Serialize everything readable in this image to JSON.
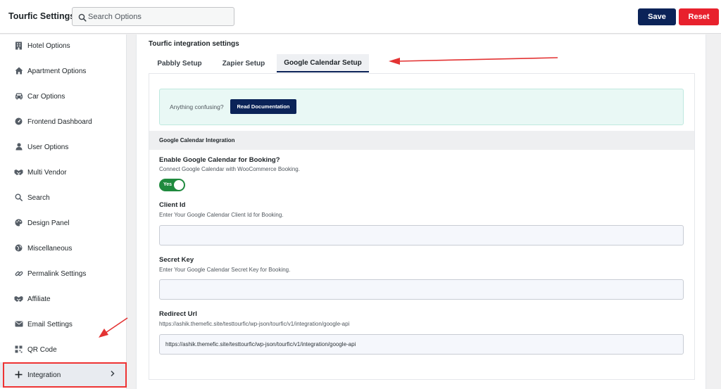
{
  "header": {
    "title": "Tourfic Settings",
    "search_placeholder": "Search Options",
    "save_label": "Save",
    "reset_label": "Reset"
  },
  "sidebar": {
    "items": [
      {
        "label": "Hotel Options",
        "icon": "building-icon"
      },
      {
        "label": "Apartment Options",
        "icon": "home-icon"
      },
      {
        "label": "Car Options",
        "icon": "car-icon"
      },
      {
        "label": "Frontend Dashboard",
        "icon": "gauge-icon"
      },
      {
        "label": "User Options",
        "icon": "user-icon"
      },
      {
        "label": "Multi Vendor",
        "icon": "handshake-icon"
      },
      {
        "label": "Search",
        "icon": "search-icon"
      },
      {
        "label": "Design Panel",
        "icon": "palette-icon"
      },
      {
        "label": "Miscellaneous",
        "icon": "globe-icon"
      },
      {
        "label": "Permalink Settings",
        "icon": "link-icon"
      },
      {
        "label": "Affiliate",
        "icon": "handshake-icon"
      },
      {
        "label": "Email Settings",
        "icon": "envelope-icon"
      },
      {
        "label": "QR Code",
        "icon": "qrcode-icon"
      },
      {
        "label": "Integration",
        "icon": "plus-icon",
        "active": true
      }
    ]
  },
  "main": {
    "section_title": "Tourfic integration settings",
    "tabs": [
      {
        "label": "Pabbly Setup"
      },
      {
        "label": "Zapier Setup"
      },
      {
        "label": "Google Calendar Setup",
        "active": true
      }
    ],
    "notice": {
      "text": "Anything confusing?",
      "button_label": "Read Documentation"
    },
    "group_title": "Google Calendar Integration",
    "enable_field": {
      "label": "Enable Google Calendar for Booking?",
      "description": "Connect Google Calendar with WooCommerce Booking.",
      "toggle_label": "Yes",
      "toggle_on": true
    },
    "client_id": {
      "label": "Client Id",
      "description": "Enter Your Google Calendar Client Id for Booking.",
      "value": ""
    },
    "secret_key": {
      "label": "Secret Key",
      "description": "Enter Your Google Calendar Secret Key for Booking.",
      "value": ""
    },
    "redirect_url": {
      "label": "Redirect Url",
      "description": "https://ashik.themefic.site/testtourfic/wp-json/tourfic/v1/integration/google-api",
      "value": "https://ashik.themefic.site/testtourfic/wp-json/tourfic/v1/integration/google-api"
    }
  },
  "colors": {
    "primary": "#0b2358",
    "danger": "#e8212d",
    "toggle_on": "#1f8a3e",
    "notice_bg": "#e9f8f5",
    "annotation": "#e33333"
  }
}
